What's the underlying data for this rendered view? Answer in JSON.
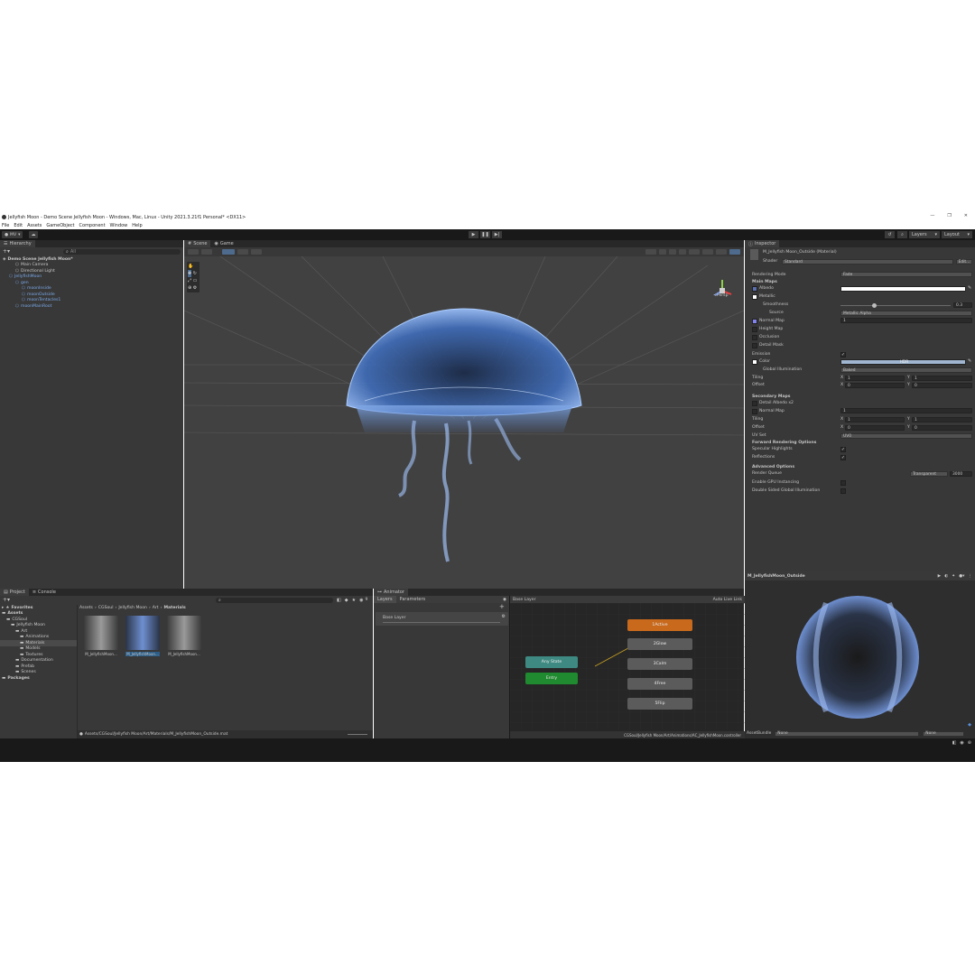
{
  "window": {
    "title": "Jellyfish Moon - Demo Scene Jellyfish Moon - Windows, Mac, Linux - Unity 2021.3.21f1 Personal* <DX11>",
    "controls": [
      "—",
      "❐",
      "✕"
    ]
  },
  "menu": [
    "File",
    "Edit",
    "Assets",
    "GameObject",
    "Component",
    "Window",
    "Help"
  ],
  "toolbar": {
    "account": "MV",
    "layers_label": "Layers",
    "layout_label": "Layout"
  },
  "hierarchy": {
    "tab": "Hierarchy",
    "search_placeholder": "All",
    "items": [
      {
        "label": "Demo Scene Jellyfish Moon*",
        "indent": 0,
        "kind": "scene"
      },
      {
        "label": "Main Camera",
        "indent": 2,
        "kind": "go"
      },
      {
        "label": "Directional Light",
        "indent": 2,
        "kind": "go"
      },
      {
        "label": "JellyfishMoon",
        "indent": 1,
        "kind": "prefab"
      },
      {
        "label": "gen",
        "indent": 2,
        "kind": "prefab"
      },
      {
        "label": "moonInside",
        "indent": 3,
        "kind": "prefab"
      },
      {
        "label": "moonOutside",
        "indent": 3,
        "kind": "prefab"
      },
      {
        "label": "moonTentacles1",
        "indent": 3,
        "kind": "prefab"
      },
      {
        "label": "moonMainRoot",
        "indent": 2,
        "kind": "prefab"
      }
    ]
  },
  "scene": {
    "tabs": [
      "Scene",
      "Game"
    ],
    "persp_label": "<Persp"
  },
  "project": {
    "tabs": [
      "Project",
      "Console"
    ],
    "favorites": "Favorites",
    "tree": [
      {
        "label": "Assets",
        "indent": 0,
        "bold": true
      },
      {
        "label": "CGSoul",
        "indent": 1
      },
      {
        "label": "Jellyfish Moon",
        "indent": 2
      },
      {
        "label": "Art",
        "indent": 3
      },
      {
        "label": "Animations",
        "indent": 4
      },
      {
        "label": "Materials",
        "indent": 4,
        "selected": true
      },
      {
        "label": "Models",
        "indent": 4
      },
      {
        "label": "Textures",
        "indent": 4
      },
      {
        "label": "Documentation",
        "indent": 3
      },
      {
        "label": "Prefab",
        "indent": 3
      },
      {
        "label": "Scenes",
        "indent": 3
      },
      {
        "label": "Packages",
        "indent": 0,
        "bold": true
      }
    ],
    "breadcrumb": [
      "Assets",
      "CGSoul",
      "Jellyfish Moon",
      "Art",
      "Materials"
    ],
    "assets": [
      {
        "label": "M_JellyfishMoon..."
      },
      {
        "label": "M_JellyfishMoon...",
        "selected": true
      },
      {
        "label": "M_JellyfishMoon..."
      }
    ],
    "count": "9",
    "footer_path": "Assets/CGSoul/Jellyfish Moon/Art/Materials/M_JellyfishMoon_Outside.mat"
  },
  "animator": {
    "tab": "Animator",
    "subtabs": [
      "Layers",
      "Parameters"
    ],
    "layer": "Base Layer",
    "graph_title": "Base Layer",
    "auto_live_link": "Auto Live Link",
    "nodes": [
      {
        "label": "1Active",
        "color": "#c8691c"
      },
      {
        "label": "2Glow",
        "color": "#5b5b5b"
      },
      {
        "label": "3Calm",
        "color": "#5b5b5b"
      },
      {
        "label": "4Free",
        "color": "#5b5b5b"
      },
      {
        "label": "5Flip",
        "color": "#5b5b5b"
      },
      {
        "label": "Any State",
        "color": "#3e8a82"
      },
      {
        "label": "Entry",
        "color": "#1f8a2f"
      }
    ],
    "footer_path": "CGSoul/Jellyfish Moon/Art/Animations/AC_JellyfishMoon.controller"
  },
  "inspector": {
    "tab": "Inspector",
    "material_name": "M_Jellyfish Moon_Outside (Material)",
    "shader_label": "Shader",
    "shader_value": "Standard",
    "edit_label": "Edit...",
    "rendering_mode_label": "Rendering Mode",
    "rendering_mode_value": "Fade",
    "main_maps": "Main Maps",
    "albedo": "Albedo",
    "metallic": "Metallic",
    "smoothness": "Smoothness",
    "smoothness_value": "0.3",
    "source": "Source",
    "source_value": "Metallic Alpha",
    "normal_map": "Normal Map",
    "normal_value": "1",
    "height_map": "Height Map",
    "occlusion": "Occlusion",
    "detail_mask": "Detail Mask",
    "emission": "Emission",
    "color": "Color",
    "hdr": "HDR",
    "global_illumination": "Global Illumination",
    "gi_value": "Baked",
    "tiling": "Tiling",
    "offset": "Offset",
    "x": "X",
    "y": "Y",
    "tiling_x": "1",
    "tiling_y": "1",
    "offset_x": "0",
    "offset_y": "0",
    "secondary_maps": "Secondary Maps",
    "detail_albedo": "Detail Albedo x2",
    "sec_normal_map": "Normal Map",
    "sec_normal_value": "1",
    "sec_tiling_x": "1",
    "sec_tiling_y": "1",
    "sec_offset_x": "0",
    "sec_offset_y": "0",
    "uv_set": "UV Set",
    "uv_value": "UV0",
    "forward_options": "Forward Rendering Options",
    "specular": "Specular Highlights",
    "reflections": "Reflections",
    "advanced": "Advanced Options",
    "render_queue": "Render Queue",
    "render_queue_mode": "Transparent",
    "render_queue_value": "3000",
    "gpu_instancing": "Enable GPU Instancing",
    "double_sided_gi": "Double Sided Global Illumination",
    "preview_title": "M_JellyfishMoon_Outside",
    "asset_bundle": "AssetBundle",
    "bundle_value": "None",
    "bundle_variant": "None"
  }
}
